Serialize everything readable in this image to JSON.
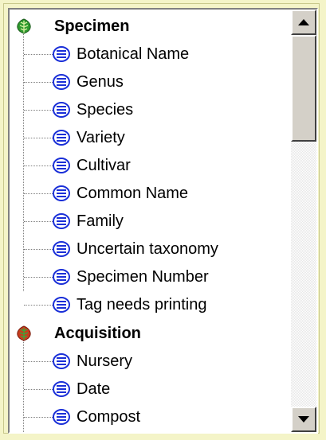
{
  "tree": {
    "categories": [
      {
        "label": "Specimen",
        "icon": "leaf-green-icon",
        "items": [
          "Botanical Name",
          "Genus",
          "Species",
          "Variety",
          "Cultivar",
          "Common Name",
          "Family",
          "Uncertain taxonomy",
          "Specimen Number",
          "Tag needs printing"
        ]
      },
      {
        "label": "Acquisition",
        "icon": "leaf-red-icon",
        "items": [
          "Nursery",
          "Date",
          "Compost"
        ]
      }
    ]
  },
  "colors": {
    "background": "#f4f4c8",
    "leaf_green": "#2e9a2e",
    "leaf_red": "#c83c1e",
    "item_icon_blue": "#1a2fd8"
  },
  "scrollbar": {
    "position_fraction": 0.0
  }
}
